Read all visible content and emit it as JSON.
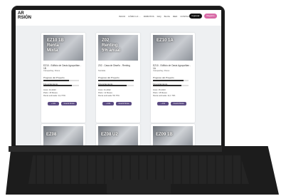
{
  "header": {
    "logo_line1": "AR",
    "logo_line2": "RSIÓN",
    "nav_items": [
      "INICIO",
      "CÓMO LO ...",
      "ROBOTOS",
      "FAQ",
      "BLOG",
      "RED",
      "CONTACTO"
    ],
    "btn_login": "Ingresar",
    "btn_register": "Registro"
  },
  "cards": [
    {
      "badge": "EZ10 1B\nRenta\nMixta",
      "title": "EZ10 - Edificio de Oasis Agropolitan - 1B",
      "subtitle": "Carapachay, Flores",
      "progress_label": "Progreso del Proyecto",
      "progress_pct": "71%",
      "funding_label": "Financiamiento",
      "funding_pct": "80%",
      "info_lines": [
        "Inicio: 04-2023",
        "Plazo: 18 Meses",
        "Renta estimada: 11,2 TPA"
      ],
      "btn_more": "+ Info",
      "btn_invest": "Invertir Ahora",
      "progress_fill": 0.71,
      "funding_fill": 0.8
    },
    {
      "badge": "Z02\nRenting\n5% anual",
      "title": "Z02 - Casa de Diseño - Renting",
      "subtitle": "Nordelta",
      "progress_label": "Progreso del Proyecto",
      "progress_pct": "100%",
      "funding_label": "Financiamiento",
      "funding_pct": "80%",
      "info_lines": [
        "Inicio: 01-2022",
        "Plazo: 12 Meses",
        "Renta estimada: 5% TPA"
      ],
      "btn_more": "+ Info",
      "btn_invest": "Invertir Ahora",
      "progress_fill": 1.0,
      "funding_fill": 0.8
    },
    {
      "badge": "EZ10 1A",
      "title": "EZ10 - Edificio de Oasis Agropolitan - 1A",
      "subtitle": "Carapachay, Flores",
      "progress_label": "Progreso del Proyecto",
      "progress_pct": "86%",
      "funding_label": "Financiamiento",
      "funding_pct": "80%",
      "info_lines": [
        "Inicio: 05-2023",
        "Plazo: 18 Meses",
        "Renta estimada: 12,1 TPA"
      ],
      "btn_more": "+ Info",
      "btn_invest": "Invertir Ahora",
      "progress_fill": 0.86,
      "funding_fill": 0.8
    }
  ],
  "row2": [
    "EZ08",
    "EZ08 U2",
    "EZ09 1B"
  ]
}
